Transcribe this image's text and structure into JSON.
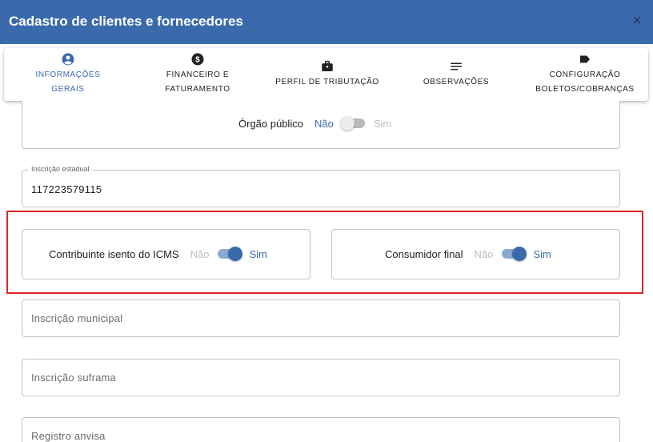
{
  "header": {
    "title": "Cadastro de clientes e fornecedores",
    "close_icon": "×"
  },
  "tabs": [
    {
      "label": "INFORMAÇÕES GERAIS",
      "icon": "account-circle-icon",
      "active": true
    },
    {
      "label_line1": "FINANCEIRO E",
      "label_line2": "FATURAMENTO",
      "icon": "dollar-circle-icon"
    },
    {
      "label": "PERFIL DE TRIBUTAÇÃO",
      "icon": "briefcase-icon"
    },
    {
      "label": "OBSERVAÇÕES",
      "icon": "notes-icon"
    },
    {
      "label_line1": "CONFIGURAÇÃO",
      "label_line2": "BOLETOS/COBRANÇAS",
      "icon": "label-tag-icon"
    }
  ],
  "form": {
    "orgao_publico": {
      "label": "Órgão público",
      "off_label": "Não",
      "on_label": "Sim",
      "checked": false
    },
    "inscricao_estadual": {
      "legend": "Inscrição estadual",
      "value": "117223579115"
    },
    "contribuinte_isento": {
      "label": "Contribuinte isento do ICMS",
      "off_label": "Não",
      "on_label": "Sim",
      "checked": true
    },
    "consumidor_final": {
      "label": "Consumidor final",
      "off_label": "Não",
      "on_label": "Sim",
      "checked": true
    },
    "inscricao_municipal": {
      "placeholder": "Inscrição municipal"
    },
    "inscricao_suframa": {
      "placeholder": "Inscrição suframa"
    },
    "registro_anvisa": {
      "placeholder": "Registro anvisa"
    }
  },
  "colors": {
    "header": "#3a6aab",
    "accent": "#3a6aab",
    "highlight": "#e0262b"
  }
}
